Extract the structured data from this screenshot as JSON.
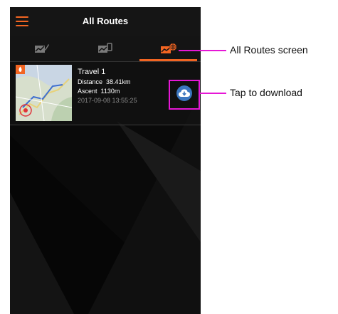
{
  "app": {
    "title": "All Routes",
    "accent": "#f26522"
  },
  "tabs": [
    {
      "icon": "route-list-icon",
      "selected": false
    },
    {
      "icon": "device-route-icon",
      "selected": false
    },
    {
      "icon": "online-routes-icon",
      "selected": true
    }
  ],
  "routes": [
    {
      "name": "Travel 1",
      "distance_label": "Distance",
      "distance": "38.41km",
      "ascent_label": "Ascent",
      "ascent": "1130m",
      "timestamp": "2017-09-08 13:55:25",
      "action_icon": "cloud-download-icon"
    }
  ],
  "callouts": {
    "screen_label": "All Routes screen",
    "download_label": "Tap to download",
    "color": "#e617d6"
  }
}
